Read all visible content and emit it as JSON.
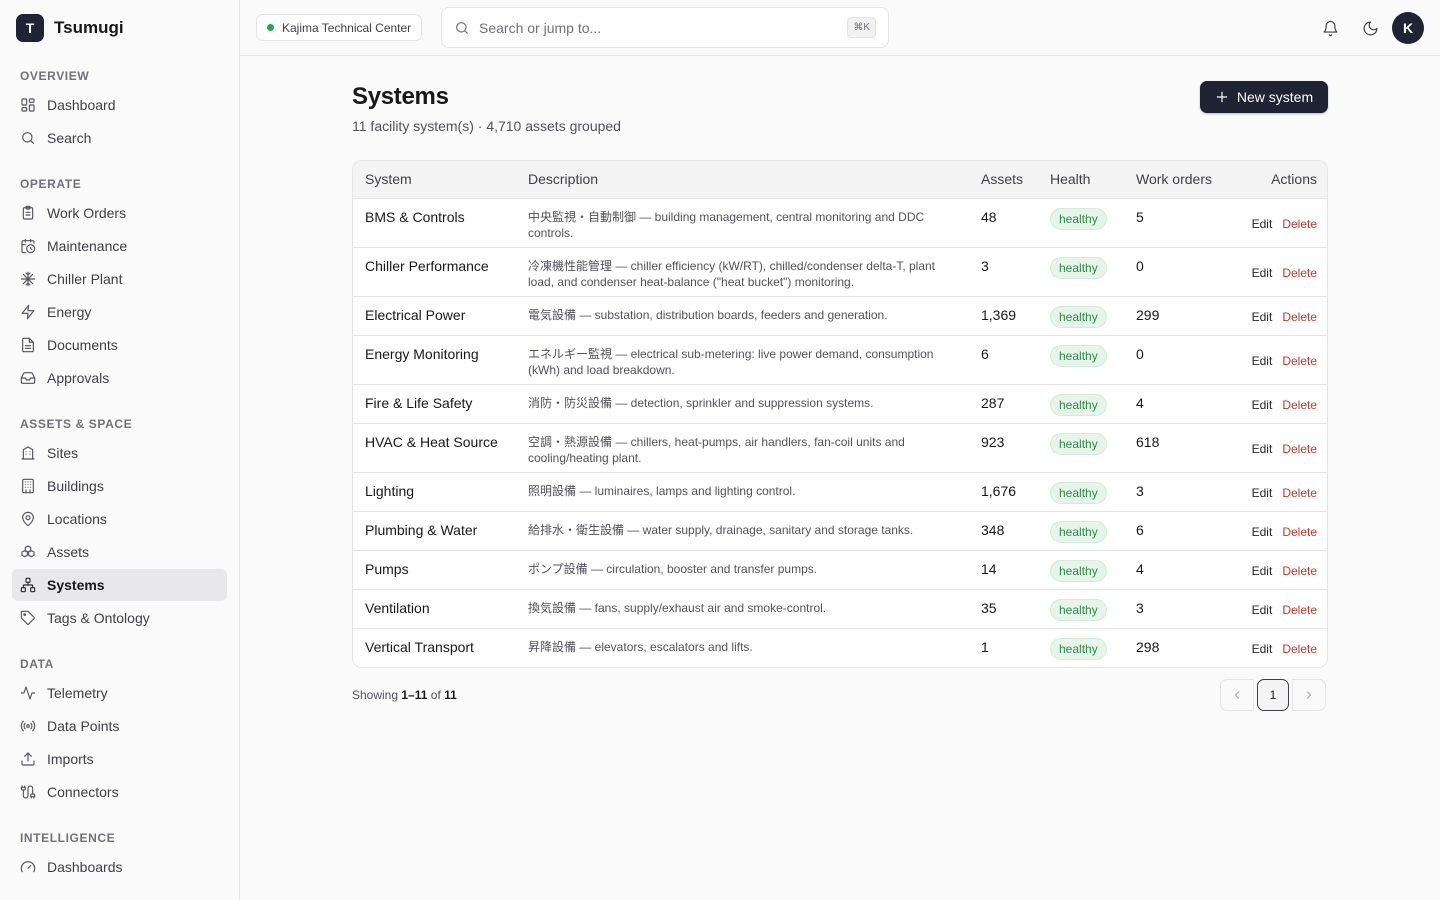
{
  "app": {
    "logo_letter": "T",
    "name": "Tsumugi"
  },
  "sidebar": {
    "sections": [
      {
        "label": "OVERVIEW",
        "items": [
          {
            "label": "Dashboard",
            "icon": "dashboard-icon"
          },
          {
            "label": "Search",
            "icon": "search-icon"
          }
        ]
      },
      {
        "label": "OPERATE",
        "items": [
          {
            "label": "Work Orders",
            "icon": "clipboard-icon"
          },
          {
            "label": "Maintenance",
            "icon": "calendar-clock-icon"
          },
          {
            "label": "Chiller Plant",
            "icon": "snowflake-icon"
          },
          {
            "label": "Energy",
            "icon": "zap-icon"
          },
          {
            "label": "Documents",
            "icon": "document-icon"
          },
          {
            "label": "Approvals",
            "icon": "inbox-icon"
          }
        ]
      },
      {
        "label": "ASSETS & SPACE",
        "items": [
          {
            "label": "Sites",
            "icon": "building-icon"
          },
          {
            "label": "Buildings",
            "icon": "building-grid-icon"
          },
          {
            "label": "Locations",
            "icon": "map-pin-icon"
          },
          {
            "label": "Assets",
            "icon": "boxes-icon"
          },
          {
            "label": "Systems",
            "icon": "network-icon",
            "active": true
          },
          {
            "label": "Tags & Ontology",
            "icon": "tag-icon"
          }
        ]
      },
      {
        "label": "DATA",
        "items": [
          {
            "label": "Telemetry",
            "icon": "activity-icon"
          },
          {
            "label": "Data Points",
            "icon": "radio-icon"
          },
          {
            "label": "Imports",
            "icon": "upload-icon"
          },
          {
            "label": "Connectors",
            "icon": "cable-icon"
          }
        ]
      },
      {
        "label": "INTELLIGENCE",
        "items": [
          {
            "label": "Dashboards",
            "icon": "gauge-icon"
          }
        ]
      }
    ]
  },
  "topbar": {
    "site": "Kajima Technical Center",
    "search_placeholder": "Search or jump to...",
    "search_shortcut": "⌘K",
    "avatar_letter": "K"
  },
  "page": {
    "title": "Systems",
    "subtitle": "11 facility system(s) · 4,710 assets grouped",
    "new_button": "New system"
  },
  "table": {
    "headers": {
      "system": "System",
      "description": "Description",
      "assets": "Assets",
      "health": "Health",
      "work_orders": "Work orders",
      "actions": "Actions"
    },
    "edit_label": "Edit",
    "delete_label": "Delete",
    "rows": [
      {
        "system": "BMS & Controls",
        "description": "中央監視・自動制御 — building management, central monitoring and DDC controls.",
        "assets": "48",
        "health": "healthy",
        "work_orders": "5"
      },
      {
        "system": "Chiller Performance",
        "description": "冷凍機性能管理 — chiller efficiency (kW/RT), chilled/condenser delta-T, plant load, and condenser heat-balance (\"heat bucket\") monitoring.",
        "assets": "3",
        "health": "healthy",
        "work_orders": "0"
      },
      {
        "system": "Electrical Power",
        "description": "電気設備 — substation, distribution boards, feeders and generation.",
        "assets": "1,369",
        "health": "healthy",
        "work_orders": "299"
      },
      {
        "system": "Energy Monitoring",
        "description": "エネルギー監視 — electrical sub-metering: live power demand, consumption (kWh) and load breakdown.",
        "assets": "6",
        "health": "healthy",
        "work_orders": "0"
      },
      {
        "system": "Fire & Life Safety",
        "description": "消防・防災設備 — detection, sprinkler and suppression systems.",
        "assets": "287",
        "health": "healthy",
        "work_orders": "4"
      },
      {
        "system": "HVAC & Heat Source",
        "description": "空調・熱源設備 — chillers, heat-pumps, air handlers, fan-coil units and cooling/heating plant.",
        "assets": "923",
        "health": "healthy",
        "work_orders": "618"
      },
      {
        "system": "Lighting",
        "description": "照明設備 — luminaires, lamps and lighting control.",
        "assets": "1,676",
        "health": "healthy",
        "work_orders": "3"
      },
      {
        "system": "Plumbing & Water",
        "description": "給排水・衛生設備 — water supply, drainage, sanitary and storage tanks.",
        "assets": "348",
        "health": "healthy",
        "work_orders": "6"
      },
      {
        "system": "Pumps",
        "description": "ポンプ設備 — circulation, booster and transfer pumps.",
        "assets": "14",
        "health": "healthy",
        "work_orders": "4"
      },
      {
        "system": "Ventilation",
        "description": "換気設備 — fans, supply/exhaust air and smoke-control.",
        "assets": "35",
        "health": "healthy",
        "work_orders": "3"
      },
      {
        "system": "Vertical Transport",
        "description": "昇降設備 — elevators, escalators and lifts.",
        "assets": "1",
        "health": "healthy",
        "work_orders": "298"
      }
    ]
  },
  "pagination": {
    "showing_prefix": "Showing",
    "range": "1–11",
    "of": "of",
    "total": "11",
    "current_page": "1"
  }
}
